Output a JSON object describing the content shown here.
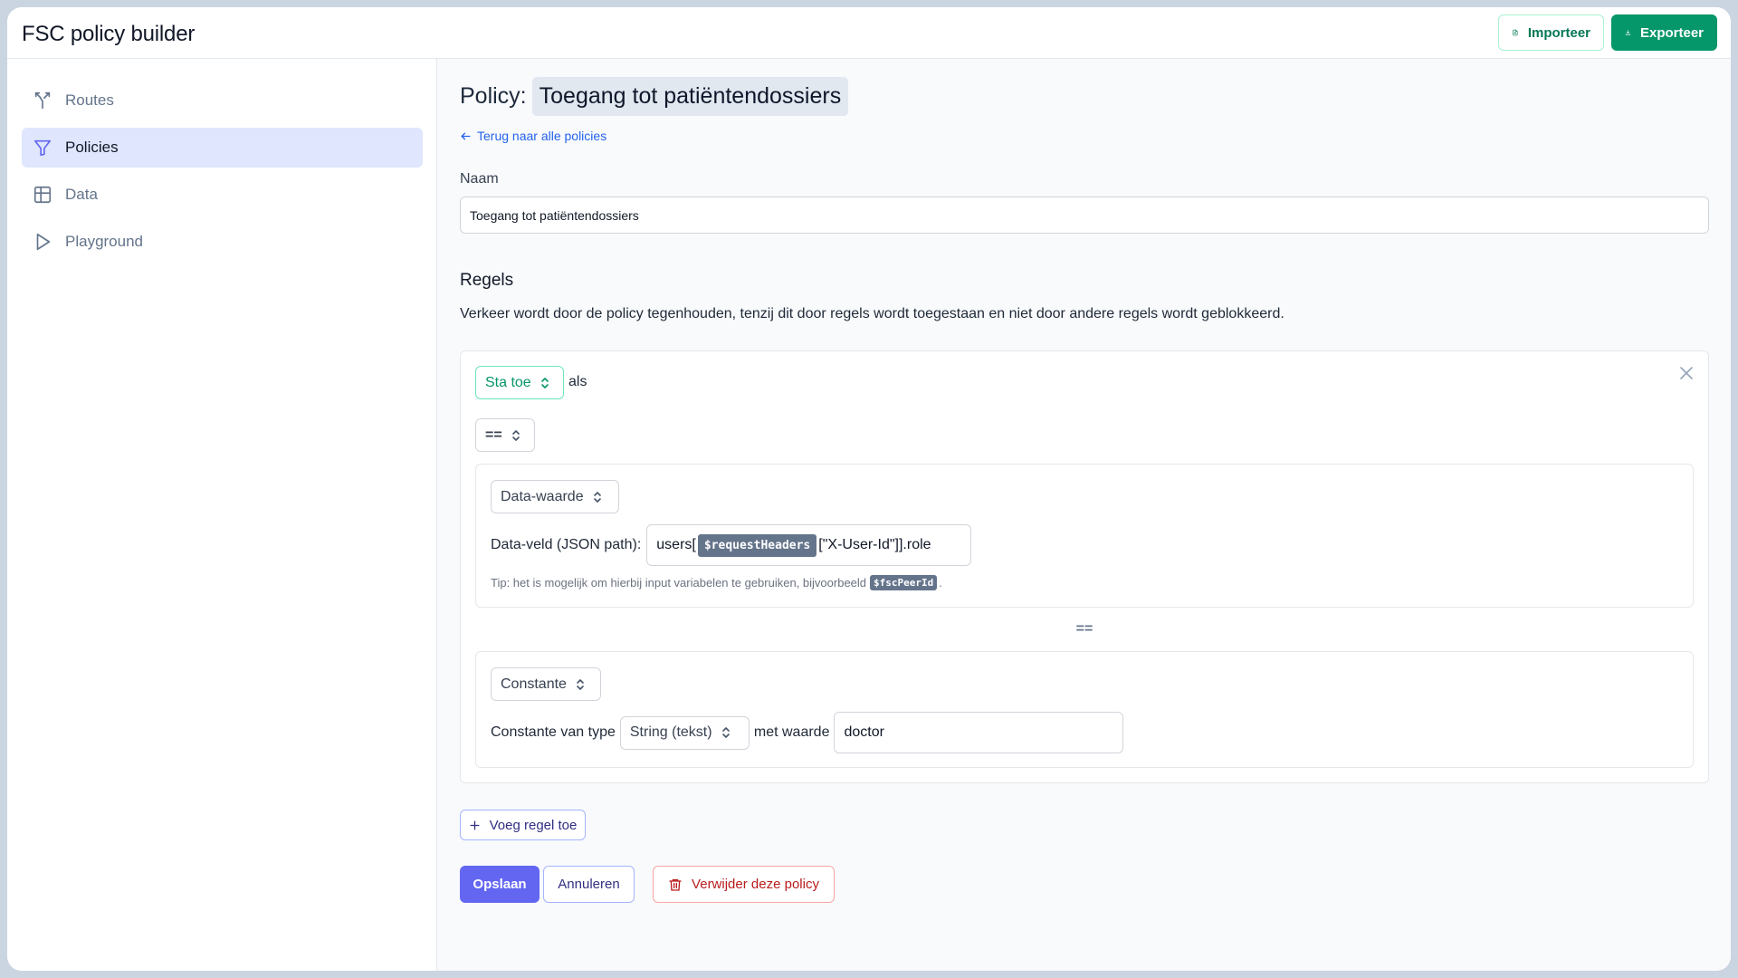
{
  "app": {
    "title": "FSC policy builder"
  },
  "header": {
    "import_label": "Importeer",
    "export_label": "Exporteer"
  },
  "sidebar": {
    "items": [
      {
        "label": "Routes",
        "icon": "routes-icon",
        "active": false
      },
      {
        "label": "Policies",
        "icon": "filter-icon",
        "active": true
      },
      {
        "label": "Data",
        "icon": "table-icon",
        "active": false
      },
      {
        "label": "Playground",
        "icon": "play-icon",
        "active": false
      }
    ]
  },
  "main": {
    "policy_prefix": "Policy:",
    "policy_name": "Toegang tot patiëntendossiers",
    "back_link": "Terug naar alle policies",
    "name_label": "Naam",
    "name_value": "Toegang tot patiëntendossiers",
    "rules_title": "Regels",
    "rules_description": "Verkeer wordt door de policy tegenhouden, tenzij dit door regels wordt toegestaan en niet door andere regels wordt geblokkeerd.",
    "rule": {
      "action": "Sta toe",
      "als": "als",
      "operator": "==",
      "left": {
        "source_type": "Data-waarde",
        "json_label": "Data-veld (JSON path):",
        "json_prefix": "users[",
        "json_variable": "$requestHeaders",
        "json_suffix": "[\"X-User-Id\"]].role",
        "tip_text": "Tip: het is mogelijk om hierbij input variabelen te gebruiken, bijvoorbeeld",
        "tip_variable": "$fscPeerId",
        "tip_end": "."
      },
      "separator": "==",
      "right": {
        "source_type": "Constante",
        "type_label": "Constante van type",
        "type_value": "String (tekst)",
        "value_label": "met waarde",
        "value": "doctor"
      }
    },
    "add_rule_label": "Voeg regel toe",
    "save_label": "Opslaan",
    "cancel_label": "Annuleren",
    "delete_label": "Verwijder deze policy"
  },
  "colors": {
    "accent": "#6366f1",
    "export": "#059669",
    "danger": "#b91c1c",
    "active_nav": "#dfe6fd"
  }
}
